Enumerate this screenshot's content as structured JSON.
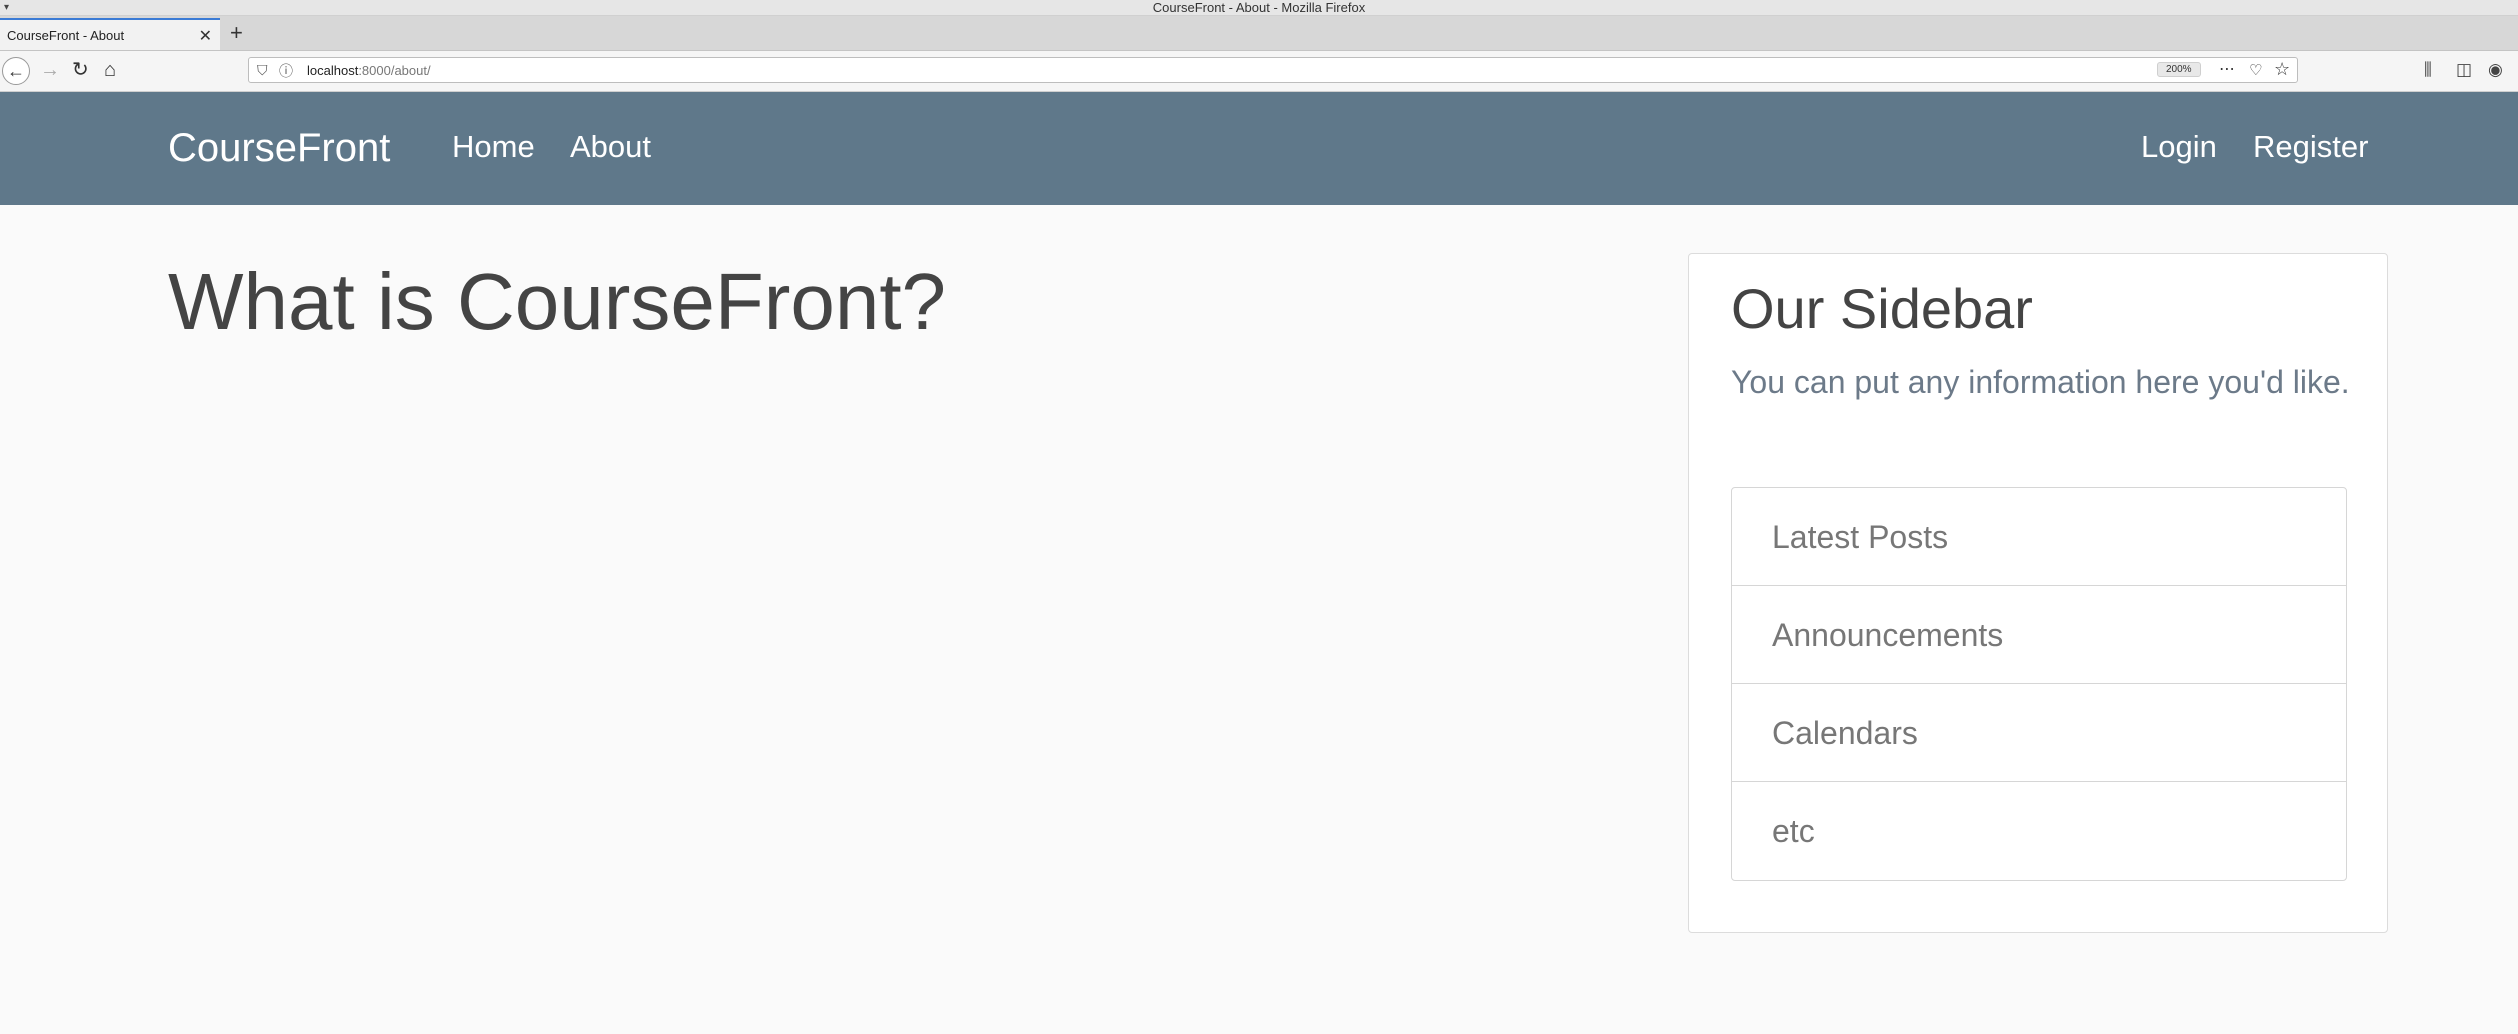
{
  "window": {
    "title": "CourseFront - About - Mozilla Firefox"
  },
  "tab": {
    "title": "CourseFront - About",
    "close_glyph": "✕",
    "new_tab_glyph": "+"
  },
  "browser": {
    "url_host": "localhost",
    "url_path": ":8000/about/",
    "zoom": "200%",
    "icons": [
      "back-arrow-icon",
      "forward-arrow-icon",
      "reload-icon",
      "home-icon",
      "shield-icon",
      "info-icon",
      "more-icon",
      "pocket-icon",
      "star-icon",
      "library-icon",
      "sidebar-icon",
      "account-icon"
    ]
  },
  "site": {
    "brand": "CourseFront",
    "nav_left": [
      "Home",
      "About"
    ],
    "nav_right": [
      "Login",
      "Register"
    ],
    "nav_color": "#5f788a"
  },
  "main": {
    "heading": "What is CourseFront?"
  },
  "sidebar": {
    "title": "Our Sidebar",
    "description": "You can put any information here you'd like.",
    "items": [
      "Latest Posts",
      "Announcements",
      "Calendars",
      "etc"
    ]
  }
}
